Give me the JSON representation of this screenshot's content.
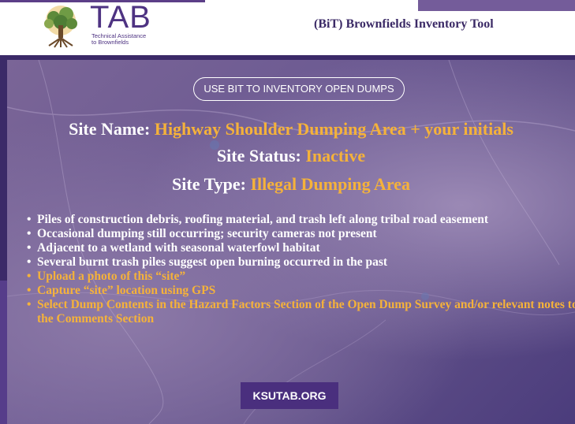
{
  "header": {
    "logo_text": "TAB",
    "logo_subtext_line1": "Technical Assistance",
    "logo_subtext_line2": "to Brownfields",
    "title": "(BiT) Brownfields Inventory Tool"
  },
  "slide": {
    "pill_label": "USE BIT TO INVENTORY OPEN DUMPS",
    "site_name_label": "Site Name: ",
    "site_name_value": "Highway Shoulder Dumping Area + your initials",
    "site_status_label": "Site Status: ",
    "site_status_value": "Inactive",
    "site_type_label": "Site Type: ",
    "site_type_value": "Illegal Dumping Area",
    "bullets": [
      "Piles of construction debris, roofing material, and trash left along tribal road easement",
      "Occasional dumping still occurring; security cameras not present",
      "Adjacent to a wetland with seasonal waterfowl habitat",
      "Several burnt trash piles suggest open burning occurred in the past",
      "Upload a photo of this “site”",
      "Capture “site” location using GPS",
      "Select Dump Contents in the Hazard Factors Section of the Open Dump Survey and/or relevant notes to the Comments Section"
    ],
    "button_label": "KSUTAB.ORG"
  },
  "colors": {
    "accent_gold": "#f5b23a",
    "brand_purple": "#4e3382",
    "button_purple": "#4a2f7e"
  },
  "icons": {
    "logo": "tree-logo-icon"
  }
}
